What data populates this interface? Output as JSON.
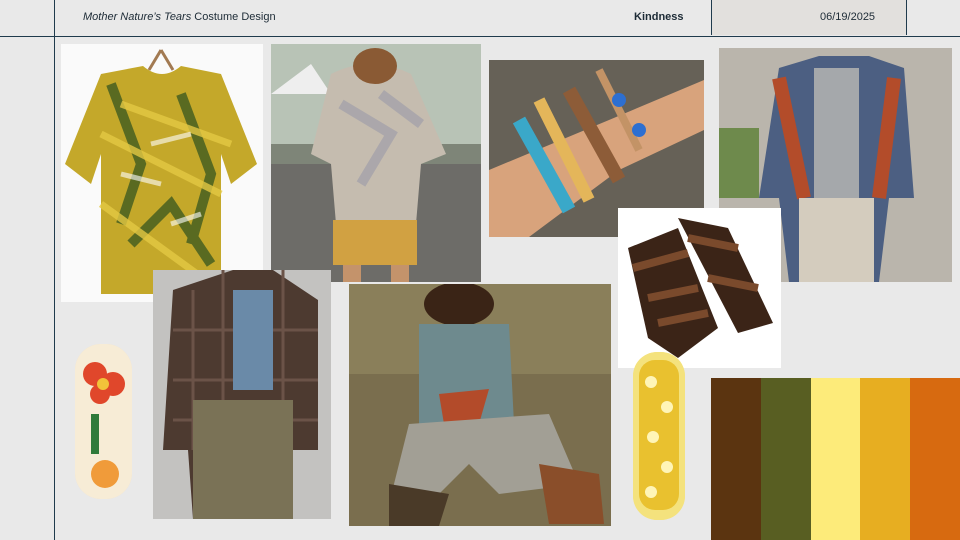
{
  "header": {
    "title_italic": "Mother Nature’s Tears",
    "title_rest": " Costume Design",
    "section": "Kindness",
    "date": "06/19/2025"
  },
  "palette": [
    "#5b3410",
    "#585e22",
    "#fdeb7a",
    "#e7ae21",
    "#d76a10"
  ],
  "images": {
    "tiedye_shirt": "tie-dye-shirt",
    "market_outfit": "market-outfit",
    "bracelets": "bracelets",
    "denim_jacket": "denim-jacket",
    "sandals": "sandals",
    "flannel_outfit": "flannel-outfit",
    "seated_person": "seated-person",
    "bandage_red_flower": "bandage-red-flower",
    "bandage_yellow_flower": "bandage-yellow-flower"
  }
}
